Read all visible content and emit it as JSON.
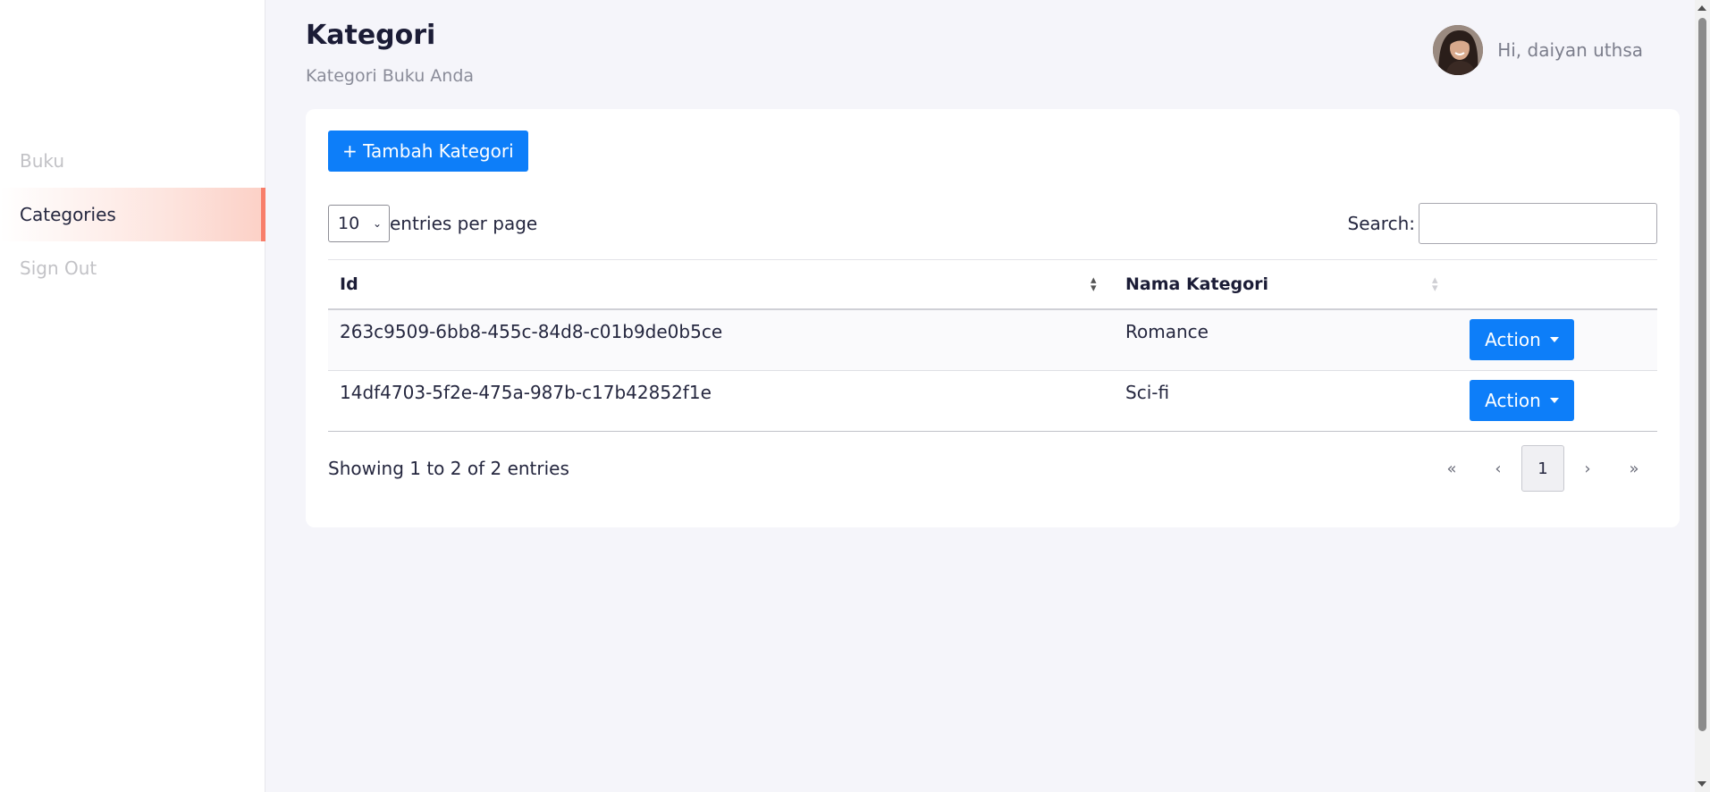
{
  "sidebar": {
    "items": [
      {
        "label": "Buku",
        "active": false
      },
      {
        "label": "Categories",
        "active": true
      },
      {
        "label": "Sign Out",
        "active": false
      }
    ]
  },
  "header": {
    "title": "Kategori",
    "subtitle": "Kategori Buku Anda",
    "greeting": "Hi, daiyan uthsa"
  },
  "toolbar": {
    "add_label": "+ Tambah Kategori",
    "entries_value": "10",
    "entries_label": "entries per page",
    "search_label": "Search:",
    "search_value": ""
  },
  "table": {
    "columns": [
      "Id",
      "Nama Kategori"
    ],
    "rows": [
      {
        "id": "263c9509-6bb8-455c-84d8-c01b9de0b5ce",
        "name": "Romance",
        "action": "Action"
      },
      {
        "id": "14df4703-5f2e-475a-987b-c17b42852f1e",
        "name": "Sci-fi",
        "action": "Action"
      }
    ]
  },
  "footer": {
    "info": "Showing 1 to 2 of 2 entries",
    "pager": {
      "first": "«",
      "prev": "‹",
      "current": "1",
      "next": "›",
      "last": "»"
    }
  },
  "colors": {
    "primary": "#0d7ef9",
    "accent": "#f87e6a"
  }
}
